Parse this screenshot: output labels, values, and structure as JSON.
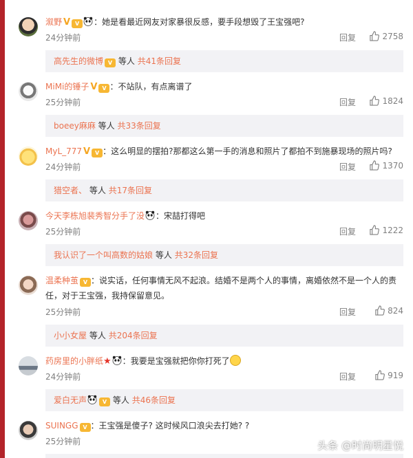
{
  "comments": [
    {
      "name": "溆野",
      "text": "她是看最近网友对家暴很反感，要手段想毁了王宝强吧?",
      "time": "24分钟前",
      "reply": "回复",
      "likes": "2758",
      "sub": {
        "name": "高先生的微博",
        "etc": "等人",
        "more": "共41条回复"
      }
    },
    {
      "name": "MiMi的锤子",
      "text": "不站队，有点离谱了",
      "time": "25分钟前",
      "reply": "回复",
      "likes": "1824",
      "sub": {
        "name": "boeey麻麻",
        "etc": "等人",
        "more": "共33条回复"
      }
    },
    {
      "name": "MyL_777",
      "text": "这么明显的摆拍?那都这么第一手的消息和照片了都拍不到施暴现场的照片吗?",
      "time": "24分钟前",
      "reply": "回复",
      "likes": "1370",
      "sub": {
        "name": "猎空者、",
        "etc": "等人",
        "more": "共17条回复"
      }
    },
    {
      "name": "今天李栋旭裴秀智分手了没",
      "text": "宋喆打得吧",
      "time": "25分钟前",
      "reply": "回复",
      "likes": "1222",
      "sub": {
        "name": "我认识了一个叫高数的姑娘",
        "etc": "等人",
        "more": "共32条回复"
      }
    },
    {
      "name": "温柔种茧",
      "text": "说实话，任何事情无风不起浪。结婚不是两个人的事情，离婚依然不是一个人的责",
      "text2": "任，对于王宝强，我持保留意见。",
      "time": "25分钟前",
      "reply": "回复",
      "likes": "824",
      "sub": {
        "name": "小小女屋",
        "etc": "等人",
        "more": "共204条回复"
      }
    },
    {
      "name": "药房里的小胖纸",
      "text": "我要是宝强就把你你打死了",
      "time": "24分钟前",
      "reply": "回复",
      "likes": "919",
      "sub": {
        "name": "爱白无声",
        "etc": "等人",
        "more": "共46条回复"
      }
    },
    {
      "name": "SUINGG",
      "text": "王宝强是傻子? 这时候风口浪尖去打她? ?",
      "time": "25分钟前"
    }
  ],
  "watermark": "头条 @时尚明星悦",
  "colors": {
    "accent": "#eb7350",
    "side_bar": "#b3242a",
    "sub_bg": "#f2f2f5",
    "meta": "#808080"
  }
}
